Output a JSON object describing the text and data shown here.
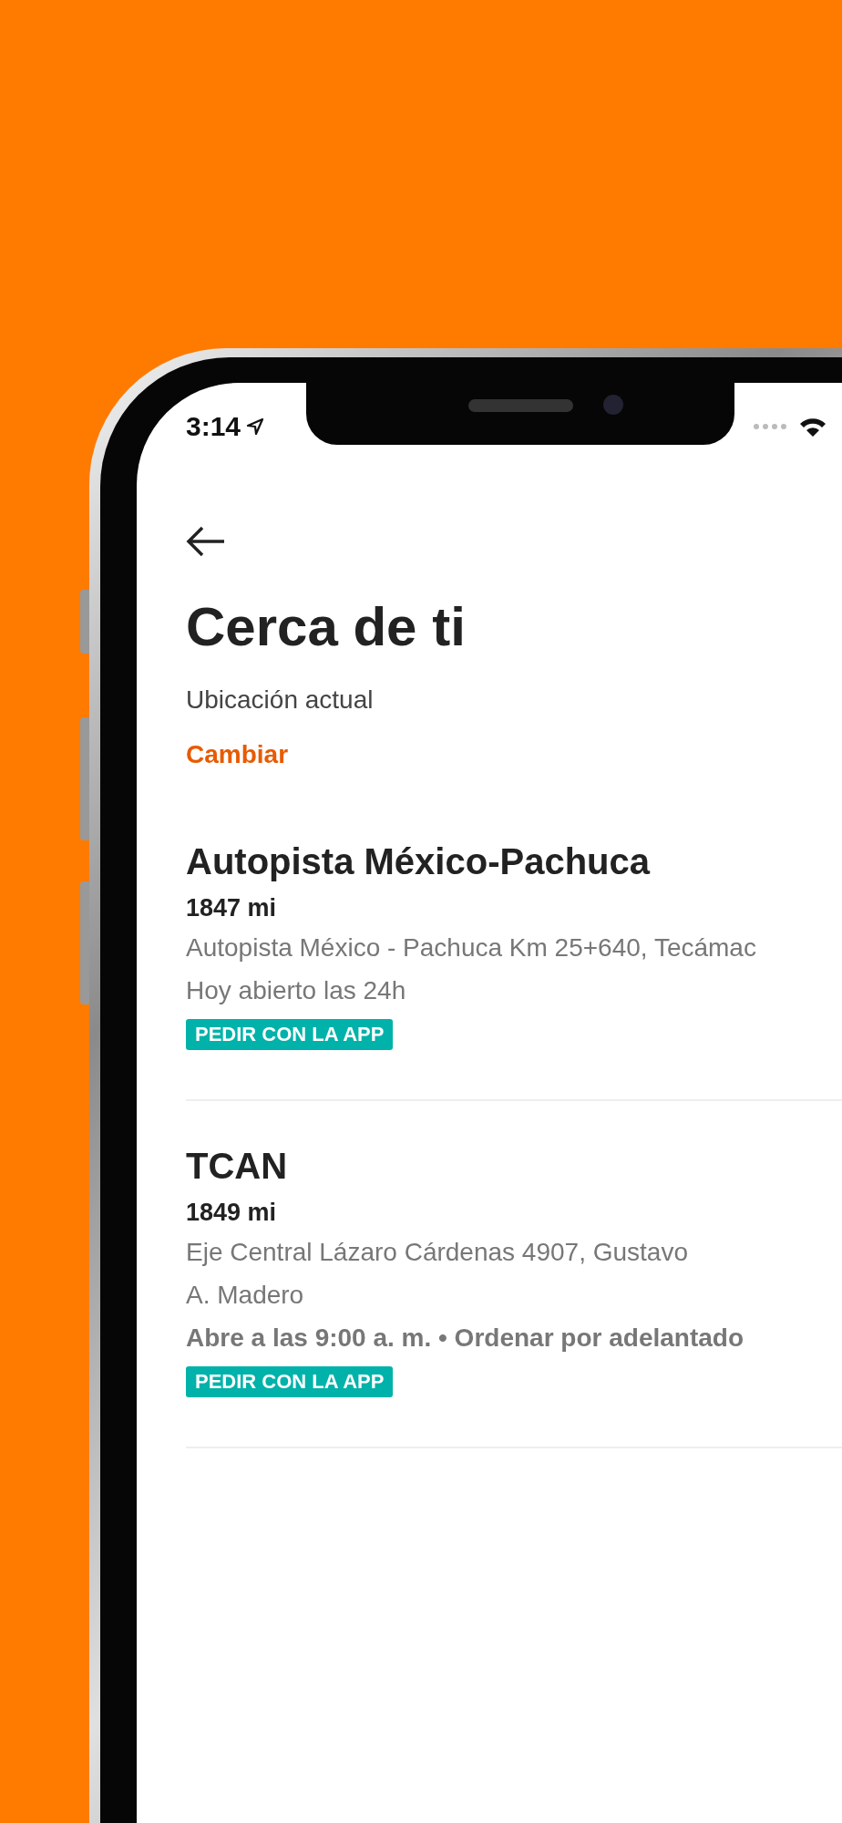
{
  "status_bar": {
    "time": "3:14"
  },
  "header": {
    "title": "Cerca de ti",
    "location_label": "Ubicación actual",
    "change_link": "Cambiar"
  },
  "stores": [
    {
      "name": "Autopista México-Pachuca",
      "distance": "1847 mi",
      "address_lines": [
        "Autopista México - Pachuca Km 25+640, Tecámac"
      ],
      "hours": "Hoy abierto las 24h",
      "hours_emphasized": false,
      "badge": "PEDIR CON LA APP"
    },
    {
      "name": "TCAN",
      "distance": "1849 mi",
      "address_lines": [
        "Eje Central Lázaro Cárdenas 4907, Gustavo",
        "A. Madero"
      ],
      "hours": "Abre a las 9:00 a. m. • Ordenar por adelantado",
      "hours_emphasized": true,
      "badge": "PEDIR CON LA APP"
    }
  ]
}
